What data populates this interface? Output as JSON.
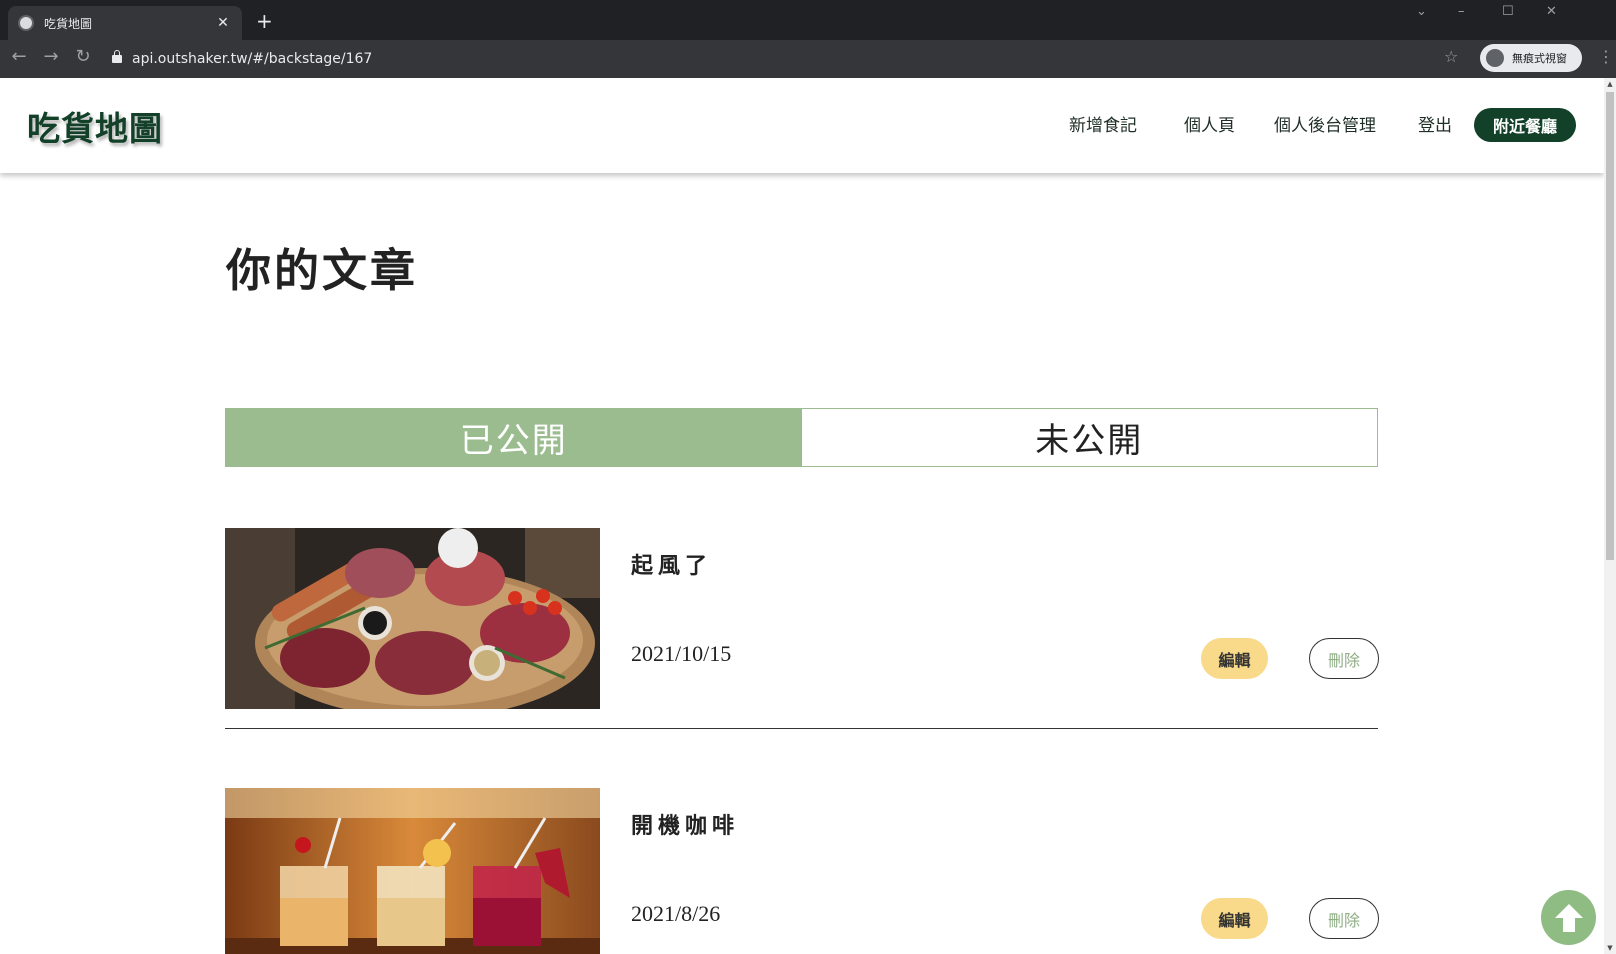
{
  "browser": {
    "tab_title": "吃貨地圖",
    "tab_close": "✕",
    "new_tab": "+",
    "url": "api.outshaker.tw/#/backstage/167",
    "incognito_label": "無痕式視窗"
  },
  "site": {
    "logo": "吃貨地圖",
    "nav": {
      "add_note": "新增食記",
      "profile": "個人頁",
      "backstage": "個人後台管理",
      "logout": "登出",
      "nearby": "附近餐廳"
    }
  },
  "page": {
    "title": "你的文章",
    "tabs": {
      "published": "已公開",
      "unpublished": "未公開"
    },
    "articles": [
      {
        "title": "起風了",
        "date": "2021/10/15",
        "edit_label": "編輯",
        "delete_label": "刪除"
      },
      {
        "title": "開機咖啡",
        "date": "2021/8/26",
        "edit_label": "編輯",
        "delete_label": "刪除"
      }
    ]
  },
  "colors": {
    "brand_dark_green": "#124029",
    "tab_active_green": "#9bbc8f",
    "edit_yellow": "#f9d98a",
    "back_to_top_green": "#8fbc83"
  }
}
